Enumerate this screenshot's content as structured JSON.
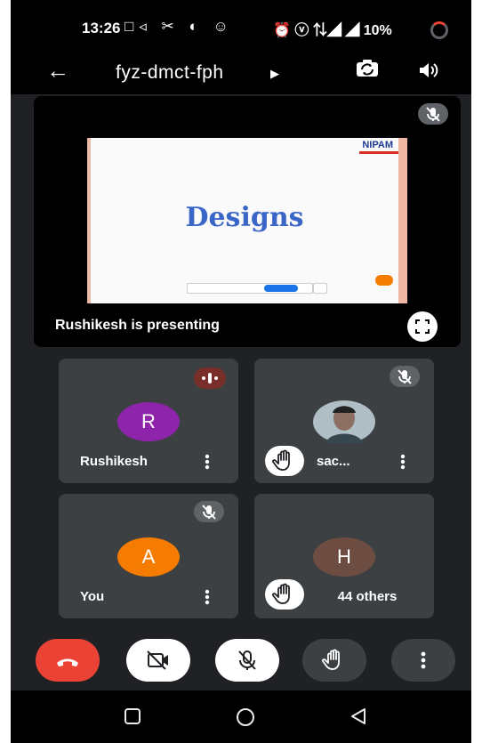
{
  "status_bar": {
    "time": "13:26",
    "icons_left": "□◃ ✂ ◐ ☺",
    "icons_right": "⏰ ⓥ ⇅◢ ◢",
    "battery": "10%"
  },
  "toolbar": {
    "meeting_code": "fyz-dmct-fph",
    "back_icon": "arrow-left-icon",
    "switch_camera_icon": "camera-switch-icon",
    "audio_icon": "speaker-icon"
  },
  "presentation": {
    "slide_logo": "NIPAM",
    "slide_title": "Designs",
    "label": "Rushikesh is presenting"
  },
  "participants": [
    {
      "name": "Rushikesh",
      "initial": "R",
      "avatar_color": "#8e24aa",
      "status": "speaking"
    },
    {
      "name": "sac...",
      "initial": "",
      "avatar_color": "",
      "status": "muted",
      "hand_raised": true
    },
    {
      "name": "You",
      "initial": "A",
      "avatar_color": "#f57c00",
      "status": "muted"
    },
    {
      "name": "",
      "initial": "H",
      "avatar_color": "#6d4c41",
      "status": "none",
      "hand_raised": true
    }
  ],
  "others_label": "44 others",
  "controls": {
    "end_call_color": "#ea4335",
    "items": [
      "end-call",
      "camera-off",
      "mic-off",
      "raise-hand",
      "more-options"
    ]
  },
  "colors": {
    "background": "#202124",
    "tile": "#3c4043",
    "accent_red": "#ea4335"
  }
}
